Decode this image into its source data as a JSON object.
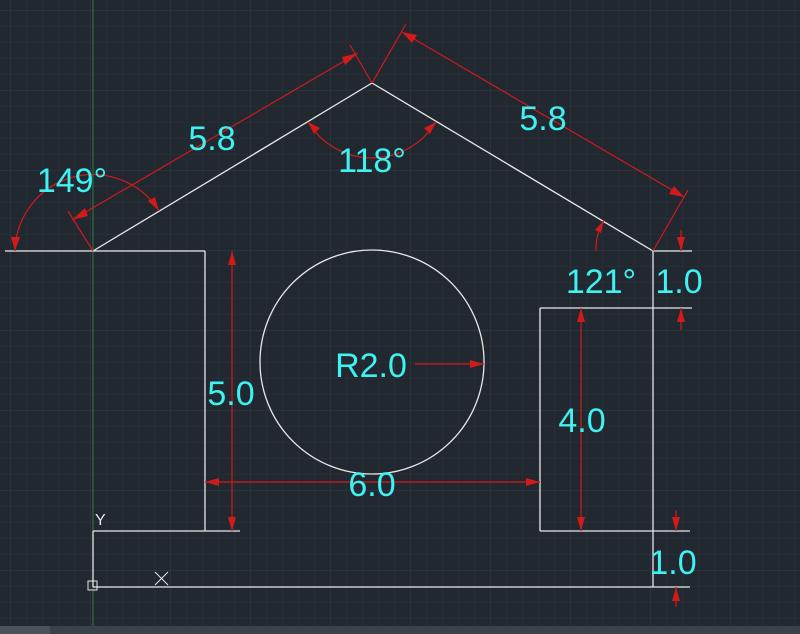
{
  "colors": {
    "background": "#212830",
    "grid_minor": "#2b323b",
    "grid_major": "#343c46",
    "geometry": "#e8e8e8",
    "dimension": "#d11a1a",
    "dimension_text": "#3ef2f2",
    "ucs": "#e6e6e6",
    "y_axis_line": "#2e7d3a",
    "status_bar": "#39414b"
  },
  "ucs": {
    "x_label": "X",
    "y_label": "Y"
  },
  "dimensions": {
    "roof_left_length": "5.8",
    "roof_right_length": "5.8",
    "angle_left_eave": "149°",
    "angle_apex": "118°",
    "angle_right_eave": "121°",
    "right_step_height": "1.0",
    "left_wall_height": "5.0",
    "circle_radius": "R2.0",
    "right_wall_height": "4.0",
    "opening_width": "6.0",
    "base_step_height": "1.0"
  }
}
